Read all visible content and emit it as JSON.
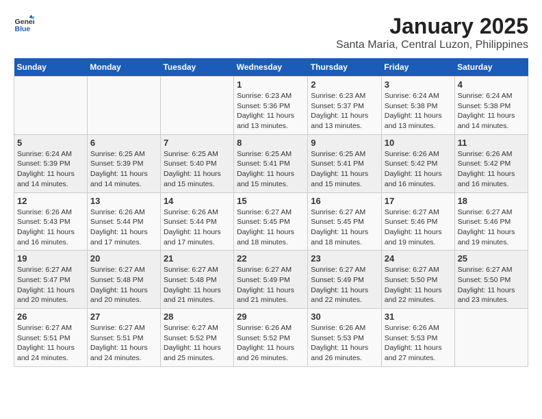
{
  "header": {
    "logo_text_general": "General",
    "logo_text_blue": "Blue",
    "title": "January 2025",
    "subtitle": "Santa Maria, Central Luzon, Philippines"
  },
  "calendar": {
    "weekdays": [
      "Sunday",
      "Monday",
      "Tuesday",
      "Wednesday",
      "Thursday",
      "Friday",
      "Saturday"
    ],
    "rows": [
      [
        {
          "day": "",
          "sunrise": "",
          "sunset": "",
          "daylight": ""
        },
        {
          "day": "",
          "sunrise": "",
          "sunset": "",
          "daylight": ""
        },
        {
          "day": "",
          "sunrise": "",
          "sunset": "",
          "daylight": ""
        },
        {
          "day": "1",
          "sunrise": "Sunrise: 6:23 AM",
          "sunset": "Sunset: 5:36 PM",
          "daylight": "Daylight: 11 hours and 13 minutes."
        },
        {
          "day": "2",
          "sunrise": "Sunrise: 6:23 AM",
          "sunset": "Sunset: 5:37 PM",
          "daylight": "Daylight: 11 hours and 13 minutes."
        },
        {
          "day": "3",
          "sunrise": "Sunrise: 6:24 AM",
          "sunset": "Sunset: 5:38 PM",
          "daylight": "Daylight: 11 hours and 13 minutes."
        },
        {
          "day": "4",
          "sunrise": "Sunrise: 6:24 AM",
          "sunset": "Sunset: 5:38 PM",
          "daylight": "Daylight: 11 hours and 14 minutes."
        }
      ],
      [
        {
          "day": "5",
          "sunrise": "Sunrise: 6:24 AM",
          "sunset": "Sunset: 5:39 PM",
          "daylight": "Daylight: 11 hours and 14 minutes."
        },
        {
          "day": "6",
          "sunrise": "Sunrise: 6:25 AM",
          "sunset": "Sunset: 5:39 PM",
          "daylight": "Daylight: 11 hours and 14 minutes."
        },
        {
          "day": "7",
          "sunrise": "Sunrise: 6:25 AM",
          "sunset": "Sunset: 5:40 PM",
          "daylight": "Daylight: 11 hours and 15 minutes."
        },
        {
          "day": "8",
          "sunrise": "Sunrise: 6:25 AM",
          "sunset": "Sunset: 5:41 PM",
          "daylight": "Daylight: 11 hours and 15 minutes."
        },
        {
          "day": "9",
          "sunrise": "Sunrise: 6:25 AM",
          "sunset": "Sunset: 5:41 PM",
          "daylight": "Daylight: 11 hours and 15 minutes."
        },
        {
          "day": "10",
          "sunrise": "Sunrise: 6:26 AM",
          "sunset": "Sunset: 5:42 PM",
          "daylight": "Daylight: 11 hours and 16 minutes."
        },
        {
          "day": "11",
          "sunrise": "Sunrise: 6:26 AM",
          "sunset": "Sunset: 5:42 PM",
          "daylight": "Daylight: 11 hours and 16 minutes."
        }
      ],
      [
        {
          "day": "12",
          "sunrise": "Sunrise: 6:26 AM",
          "sunset": "Sunset: 5:43 PM",
          "daylight": "Daylight: 11 hours and 16 minutes."
        },
        {
          "day": "13",
          "sunrise": "Sunrise: 6:26 AM",
          "sunset": "Sunset: 5:44 PM",
          "daylight": "Daylight: 11 hours and 17 minutes."
        },
        {
          "day": "14",
          "sunrise": "Sunrise: 6:26 AM",
          "sunset": "Sunset: 5:44 PM",
          "daylight": "Daylight: 11 hours and 17 minutes."
        },
        {
          "day": "15",
          "sunrise": "Sunrise: 6:27 AM",
          "sunset": "Sunset: 5:45 PM",
          "daylight": "Daylight: 11 hours and 18 minutes."
        },
        {
          "day": "16",
          "sunrise": "Sunrise: 6:27 AM",
          "sunset": "Sunset: 5:45 PM",
          "daylight": "Daylight: 11 hours and 18 minutes."
        },
        {
          "day": "17",
          "sunrise": "Sunrise: 6:27 AM",
          "sunset": "Sunset: 5:46 PM",
          "daylight": "Daylight: 11 hours and 19 minutes."
        },
        {
          "day": "18",
          "sunrise": "Sunrise: 6:27 AM",
          "sunset": "Sunset: 5:46 PM",
          "daylight": "Daylight: 11 hours and 19 minutes."
        }
      ],
      [
        {
          "day": "19",
          "sunrise": "Sunrise: 6:27 AM",
          "sunset": "Sunset: 5:47 PM",
          "daylight": "Daylight: 11 hours and 20 minutes."
        },
        {
          "day": "20",
          "sunrise": "Sunrise: 6:27 AM",
          "sunset": "Sunset: 5:48 PM",
          "daylight": "Daylight: 11 hours and 20 minutes."
        },
        {
          "day": "21",
          "sunrise": "Sunrise: 6:27 AM",
          "sunset": "Sunset: 5:48 PM",
          "daylight": "Daylight: 11 hours and 21 minutes."
        },
        {
          "day": "22",
          "sunrise": "Sunrise: 6:27 AM",
          "sunset": "Sunset: 5:49 PM",
          "daylight": "Daylight: 11 hours and 21 minutes."
        },
        {
          "day": "23",
          "sunrise": "Sunrise: 6:27 AM",
          "sunset": "Sunset: 5:49 PM",
          "daylight": "Daylight: 11 hours and 22 minutes."
        },
        {
          "day": "24",
          "sunrise": "Sunrise: 6:27 AM",
          "sunset": "Sunset: 5:50 PM",
          "daylight": "Daylight: 11 hours and 22 minutes."
        },
        {
          "day": "25",
          "sunrise": "Sunrise: 6:27 AM",
          "sunset": "Sunset: 5:50 PM",
          "daylight": "Daylight: 11 hours and 23 minutes."
        }
      ],
      [
        {
          "day": "26",
          "sunrise": "Sunrise: 6:27 AM",
          "sunset": "Sunset: 5:51 PM",
          "daylight": "Daylight: 11 hours and 24 minutes."
        },
        {
          "day": "27",
          "sunrise": "Sunrise: 6:27 AM",
          "sunset": "Sunset: 5:51 PM",
          "daylight": "Daylight: 11 hours and 24 minutes."
        },
        {
          "day": "28",
          "sunrise": "Sunrise: 6:27 AM",
          "sunset": "Sunset: 5:52 PM",
          "daylight": "Daylight: 11 hours and 25 minutes."
        },
        {
          "day": "29",
          "sunrise": "Sunrise: 6:26 AM",
          "sunset": "Sunset: 5:52 PM",
          "daylight": "Daylight: 11 hours and 26 minutes."
        },
        {
          "day": "30",
          "sunrise": "Sunrise: 6:26 AM",
          "sunset": "Sunset: 5:53 PM",
          "daylight": "Daylight: 11 hours and 26 minutes."
        },
        {
          "day": "31",
          "sunrise": "Sunrise: 6:26 AM",
          "sunset": "Sunset: 5:53 PM",
          "daylight": "Daylight: 11 hours and 27 minutes."
        },
        {
          "day": "",
          "sunrise": "",
          "sunset": "",
          "daylight": ""
        }
      ]
    ]
  }
}
